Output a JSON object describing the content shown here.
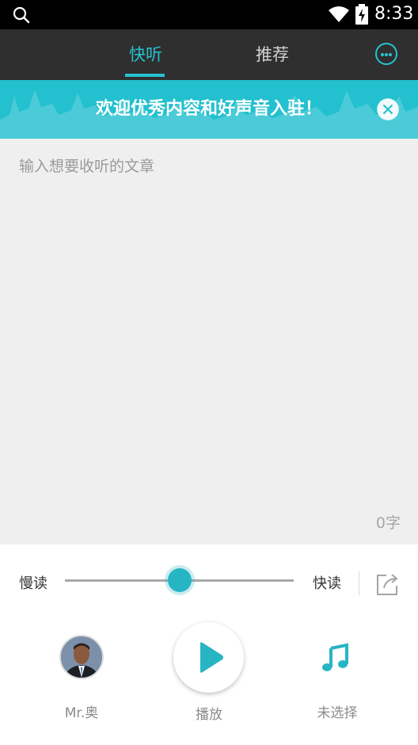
{
  "status_bar": {
    "time": "8:33"
  },
  "header": {
    "tabs": [
      {
        "label": "快听",
        "active": true
      },
      {
        "label": "推荐",
        "active": false
      }
    ],
    "more_icon": "more-dots-icon"
  },
  "banner": {
    "text": "欢迎优秀内容和好声音入驻！",
    "close_icon": "close-icon"
  },
  "editor": {
    "placeholder": "输入想要收听的文章",
    "char_count": "0字"
  },
  "speed": {
    "slow_label": "慢读",
    "fast_label": "快读",
    "value_fraction": 0.5
  },
  "controls": {
    "voice_label": "Mr.奥",
    "play_label": "播放",
    "music_label": "未选择"
  },
  "colors": {
    "accent": "#27c2d1",
    "header_bg": "#2f2f2f",
    "banner_bg": "#23c0cf",
    "editor_bg": "#efefef"
  }
}
